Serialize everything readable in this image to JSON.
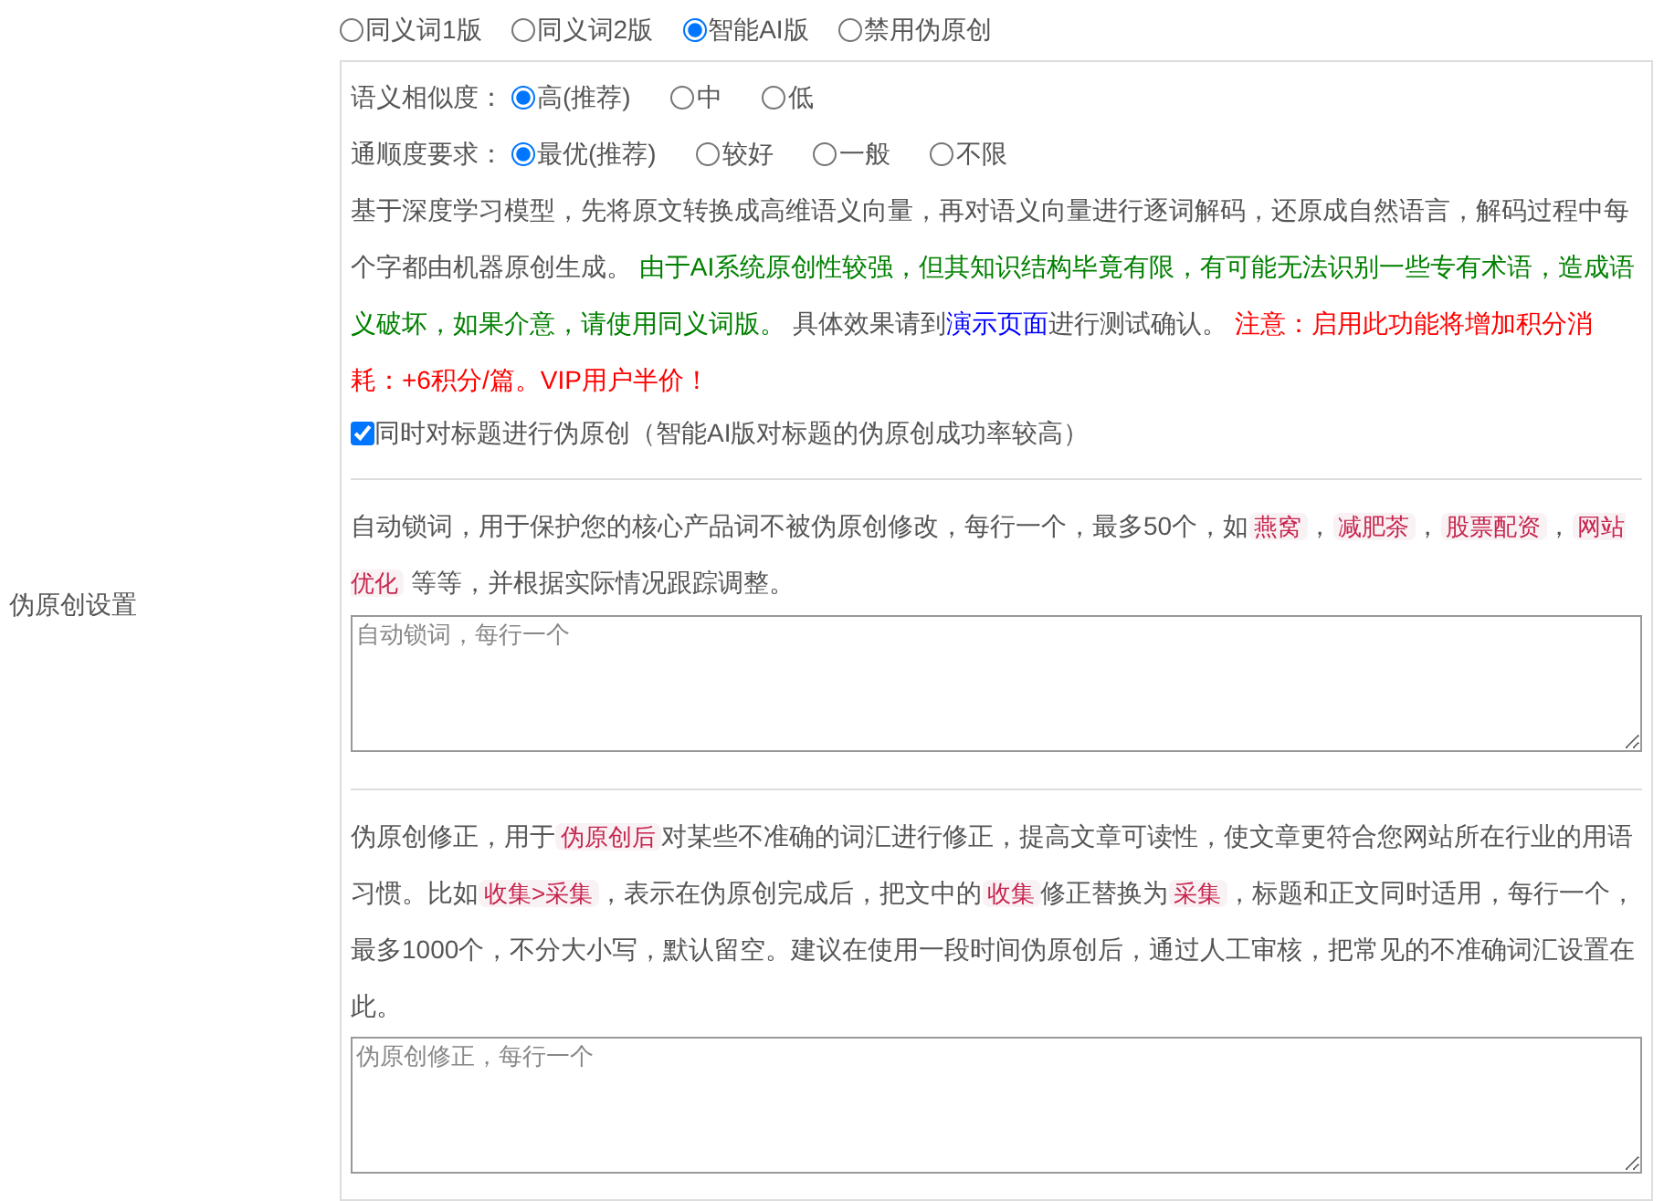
{
  "side_label": "伪原创设置",
  "mode_options": [
    {
      "label": "同义词1版",
      "selected": false
    },
    {
      "label": "同义词2版",
      "selected": false
    },
    {
      "label": "智能AI版",
      "selected": true
    },
    {
      "label": "禁用伪原创",
      "selected": false
    }
  ],
  "similarity": {
    "label": "语义相似度：",
    "options": [
      {
        "label": "高(推荐)",
        "selected": true
      },
      {
        "label": "中",
        "selected": false
      },
      {
        "label": "低",
        "selected": false
      }
    ]
  },
  "fluency": {
    "label": "通顺度要求：",
    "options": [
      {
        "label": "最优(推荐)",
        "selected": true
      },
      {
        "label": "较好",
        "selected": false
      },
      {
        "label": "一般",
        "selected": false
      },
      {
        "label": "不限",
        "selected": false
      }
    ]
  },
  "ai_description": [
    {
      "kind": "text",
      "text": "基于深度学习模型，先将原文转换成高维语义向量，再对语义向量进行逐词解码，还原成自然语言，解码过程中每个字都由机器原创生成。 "
    },
    {
      "kind": "green",
      "text": "由于AI系统原创性较强，但其知识结构毕竟有限，有可能无法识别一些专有术语，造成语义破坏，如果介意，请使用同义词版。"
    },
    {
      "kind": "text",
      "text": " 具体效果请到"
    },
    {
      "kind": "link",
      "text": "演示页面"
    },
    {
      "kind": "text",
      "text": "进行测试确认。 "
    },
    {
      "kind": "red",
      "text": "注意：启用此功能将增加积分消耗：+6积分/篇。VIP用户半价！"
    }
  ],
  "title_option": {
    "label": "同时对标题进行伪原创（智能AI版对标题的伪原创成功率较高）",
    "checked": true
  },
  "auto_lock": {
    "description": [
      {
        "kind": "text",
        "text": "自动锁词，用于保护您的核心产品词不被伪原创修改，每行一个，最多50个，如"
      },
      {
        "kind": "tag",
        "text": "燕窝"
      },
      {
        "kind": "text",
        "text": "，"
      },
      {
        "kind": "tag",
        "text": "减肥茶"
      },
      {
        "kind": "text",
        "text": "，"
      },
      {
        "kind": "tag",
        "text": "股票配资"
      },
      {
        "kind": "text",
        "text": "，"
      },
      {
        "kind": "tag",
        "text": "网站优化"
      },
      {
        "kind": "text",
        "text": " 等等，并根据实际情况跟踪调整。"
      }
    ],
    "placeholder": "自动锁词，每行一个"
  },
  "correction": {
    "description": [
      {
        "kind": "text",
        "text": "伪原创修正，用于"
      },
      {
        "kind": "tag",
        "text": "伪原创后"
      },
      {
        "kind": "text",
        "text": "对某些不准确的词汇进行修正，提高文章可读性，使文章更符合您网站所在行业的用语习惯。比如"
      },
      {
        "kind": "tag",
        "text": "收集>采集"
      },
      {
        "kind": "text",
        "text": "，表示在伪原创完成后，把文中的"
      },
      {
        "kind": "tag",
        "text": "收集"
      },
      {
        "kind": "text",
        "text": "修正替换为"
      },
      {
        "kind": "tag",
        "text": "采集"
      },
      {
        "kind": "text",
        "text": "，标题和正文同时适用，每行一个，最多1000个，不分大小写，默认留空。建议在使用一段时间伪原创后，通过人工审核，把常见的不准确词汇设置在此。"
      }
    ],
    "placeholder": "伪原创修正，每行一个"
  }
}
